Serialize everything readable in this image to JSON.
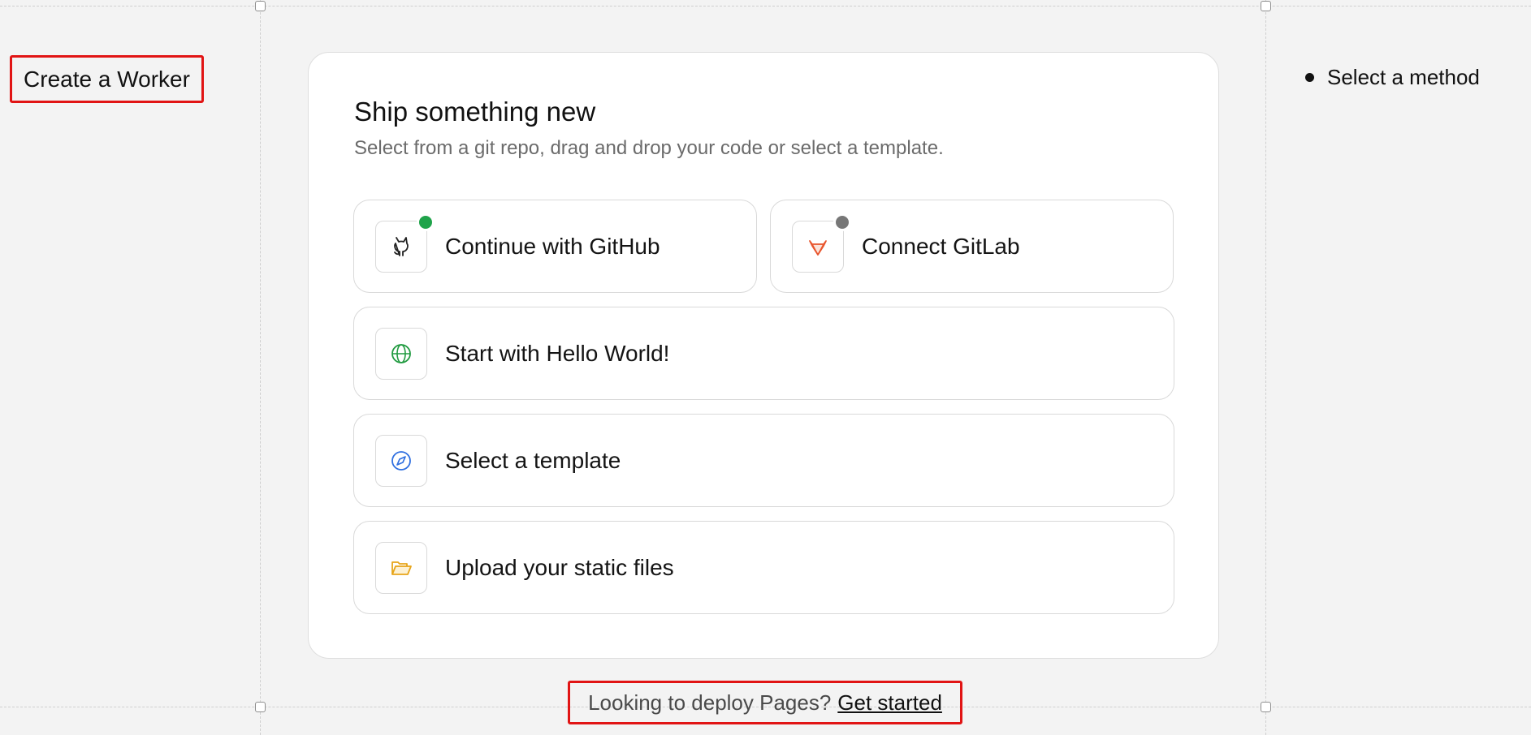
{
  "sidebar": {
    "title": "Create a Worker"
  },
  "steps": {
    "current": "Select a method"
  },
  "card": {
    "title": "Ship something new",
    "subtitle": "Select from a git repo, drag and drop your code or select a template.",
    "options": [
      {
        "label": "Continue with GitHub",
        "icon": "github-icon",
        "status": "connected",
        "status_color": "#1fa34a"
      },
      {
        "label": "Connect GitLab",
        "icon": "gitlab-icon",
        "status": "not-connected",
        "status_color": "#777777"
      },
      {
        "label": "Start with Hello World!",
        "icon": "globe-icon"
      },
      {
        "label": "Select a template",
        "icon": "compass-icon"
      },
      {
        "label": "Upload your static files",
        "icon": "folder-icon"
      }
    ]
  },
  "footer": {
    "prompt": "Looking to deploy Pages?",
    "link": "Get started"
  },
  "colors": {
    "highlight": "#e11414",
    "github_status": "#1fa34a",
    "gitlab_status": "#777777",
    "globe": "#1f9a3f",
    "compass": "#2f6fe0",
    "folder": "#e7a51a",
    "gitlab": "#e8552d"
  }
}
